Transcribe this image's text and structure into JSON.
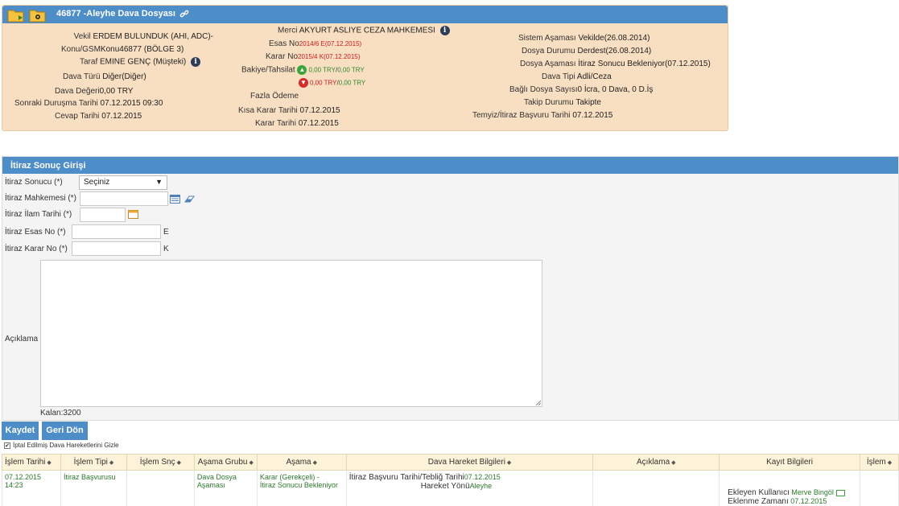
{
  "case": {
    "title": "46877 -Aleyhe Dava Dosyası",
    "left": [
      {
        "label": "Vekil",
        "value": "ERDEM BULUNDUK (AHI, ADC)-"
      },
      {
        "label": "Konu/GSM",
        "value": "Konu46877 (BÖLGE 3)"
      },
      {
        "label": "Taraf",
        "value": "EMINE GENÇ (Müşteki)"
      },
      {
        "label": "Dava Türü",
        "value": "Diğer(Diğer)"
      },
      {
        "label": "Dava Değeri",
        "value": "0,00 TRY"
      },
      {
        "label": "Sonraki Duruşma Tarihi",
        "value": "07.12.2015 09:30"
      },
      {
        "label": "Cevap Tarihi",
        "value": "07.12.2015"
      }
    ],
    "middle": {
      "merci_label": "Merci",
      "merci_value": "AKYURT ASLIYE CEZA MAHKEMESI",
      "esas_label": "Esas No",
      "esas_value": "2014/6 E(07.12.2015)",
      "karar_label": "Karar No",
      "karar_value": "2015/4 K(07.12.2015)",
      "bakiye_label": "Bakiye/Tahsilat",
      "bakiye_line1_a": "0,00 TRY",
      "bakiye_line1_b": "0,00 TRY",
      "bakiye_line2_a": "0,00 TRY",
      "bakiye_line2_b": "0,00 TRY",
      "fazla_label": "Fazla Ödeme",
      "kisa_label": "Kısa Karar Tarihi",
      "kisa_value": "07.12.2015",
      "karartarihi_label": "Karar Tarihi",
      "karartarihi_value": "07.12.2015"
    },
    "right": [
      {
        "label": "Sistem Aşaması",
        "value": "Vekilde(26.08.2014)"
      },
      {
        "label": "Dosya Durumu",
        "value": "Derdest(26.08.2014)"
      },
      {
        "label": "Dosya Aşaması",
        "value": "İtiraz Sonucu Bekleniyor(07.12.2015)"
      },
      {
        "label": "Dava Tipi",
        "value": "Adli/Ceza"
      },
      {
        "label": "Bağlı Dosya Sayısı",
        "value": "0 İcra, 0 Dava, 0 D.İş"
      },
      {
        "label": "Takip Durumu",
        "value": "Takipte"
      },
      {
        "label": "Temyiz/İtiraz Başvuru Tarihi",
        "value": "07.12.2015"
      }
    ]
  },
  "form": {
    "title": "İtiraz Sonuç Girişi",
    "sonuc_label": "İtiraz Sonucu (*)",
    "sonuc_value": "Seçiniz",
    "mahkeme_label": "İtiraz Mahkemesi (*)",
    "ilam_label": "İtiraz İlam Tarihi (*)",
    "esas_label": "İtiraz Esas No (*)",
    "esas_suffix": "E",
    "karar_label": "İtiraz Karar No (*)",
    "karar_suffix": "K",
    "aciklama_label": "Açıklama",
    "remaining": "Kalan:3200"
  },
  "buttons": {
    "save": "Kaydet",
    "back": "Geri Dön"
  },
  "hide_cancelled": "İptal Edilmiş Dava Hareketlerini Gizle",
  "table": {
    "headers": [
      "İşlem Tarihi",
      "İşlem Tipi",
      "İşlem Snç",
      "Aşama Grubu",
      "Aşama",
      "Dava Hareket Bilgileri",
      "Açıklama",
      "Kayıt Bilgileri",
      "İşlem"
    ],
    "row": {
      "tarih_line1": "07.12.2015",
      "tarih_line2": "14:23",
      "tip": "İtiraz Başvurusu",
      "snc": "",
      "grup_line1": "Dava Dosya",
      "grup_line2": "Aşaması",
      "asama_line1": "Karar (Gerekçeli) -",
      "asama_line2": "İtiraz Sonucu Bekleniyor",
      "hareket_label1": "İtiraz Başvuru Tarihi/Tebliğ Tarihi",
      "hareket_value1": "07.12.2015",
      "hareket_label2": "Hareket Yönü",
      "hareket_value2": "Aleyhe",
      "aciklama": "",
      "kayit_label1": "Ekleyen Kullanıcı",
      "kayit_value1": "Merve Bingöl",
      "kayit_label2": "Eklenme Zamanı",
      "kayit_value2": "07.12.2015"
    }
  },
  "colors": {
    "header_blue": "#4d8ec9",
    "panel_peach": "#f8dfc2",
    "table_header": "#fdf3d8",
    "accent_red": "#d01a1a",
    "accent_green": "#2a8a2a"
  }
}
